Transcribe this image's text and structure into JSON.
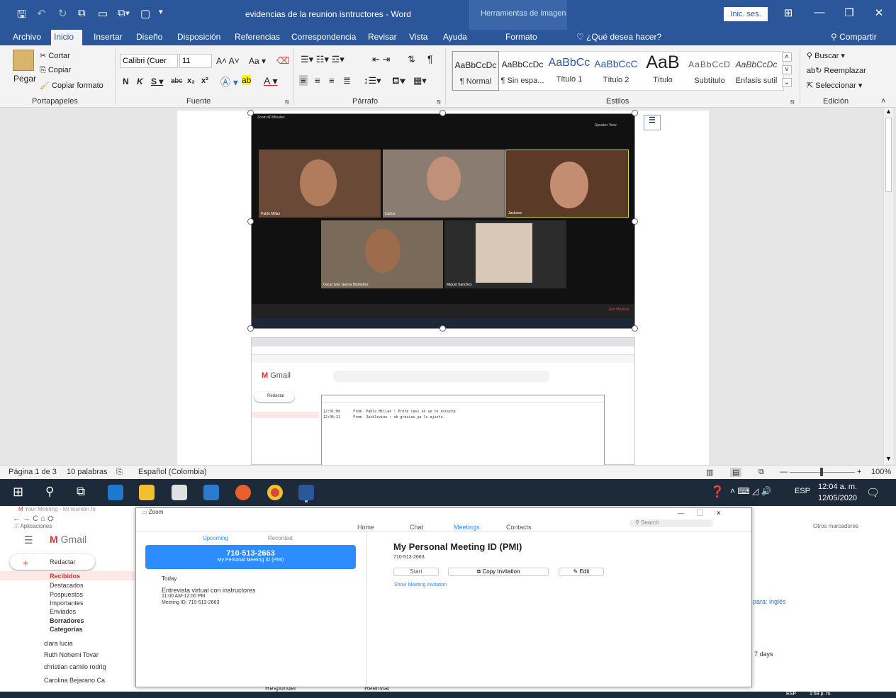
{
  "word": {
    "doc_title": "evidencias de la reunion isntructores  -  Word",
    "context_tab": "Herramientas de imagen",
    "signin": "Inic. ses.",
    "menu": [
      "Archivo",
      "Inicio",
      "Insertar",
      "Diseño",
      "Disposición",
      "Referencias",
      "Correspondencia",
      "Revisar",
      "Vista",
      "Ayuda",
      "Formato"
    ],
    "tell_me": "¿Qué desea hacer?",
    "share": "Compartir",
    "clipboard": {
      "paste": "Pegar",
      "cut": "Cortar",
      "copy": "Copiar",
      "format_painter": "Copiar formato",
      "label": "Portapapeles"
    },
    "font": {
      "name": "Calibri (Cuer",
      "size": "11",
      "label": "Fuente",
      "case": "Aa"
    },
    "paragraph_label": "Párrafo",
    "styles": {
      "label": "Estilos",
      "items": [
        {
          "sample": "AaBbCcDc",
          "name": "¶ Normal"
        },
        {
          "sample": "AaBbCcDc",
          "name": "¶ Sin espa..."
        },
        {
          "sample": "AaBbCc",
          "name": "Título 1"
        },
        {
          "sample": "AaBbCcC",
          "name": "Título 2"
        },
        {
          "sample": "AaB",
          "name": "Título"
        },
        {
          "sample": "AaBbCcD",
          "name": "Subtítulo"
        },
        {
          "sample": "AaBbCcDc",
          "name": "Énfasis sutil"
        }
      ]
    },
    "editing": {
      "find": "Buscar",
      "replace": "Reemplazar",
      "select": "Seleccionar",
      "label": "Edición"
    },
    "status": {
      "page": "Página 1 de 3",
      "words": "10 palabras",
      "language": "Español (Colombia)",
      "zoom": "100%"
    }
  },
  "embedded_zoom": {
    "title": "Zoom 40 Minutes",
    "speaker_view": "Speaker View",
    "participants": [
      "Pablo Millan",
      "Carlos",
      "Jacksive",
      "Oscar Ivan Garcia Montañez",
      "Miguel Sanchez"
    ],
    "end_meeting": "End Meeting"
  },
  "embedded_chat": {
    "line1": "12:01:08      From  Pablo Millan : Profe casi no se te escucha",
    "line2": "12:06:21      From  Jacklevine : ok gracias ya lo ajusto."
  },
  "taskbar": {
    "time": "12:04 a. m.",
    "date": "12/05/2020",
    "lang": "ESP"
  },
  "lower": {
    "gmail": {
      "tab_title": "Your Meeting - Mi reunión fe",
      "apps": "Aplicaciones",
      "bookmarks_other": "Otros marcadores",
      "logo": "Gmail",
      "compose": "Redactar",
      "nav": [
        "Recibidos",
        "Destacados",
        "Pospuestos",
        "Importantes",
        "Enviados",
        "Borradores",
        "Categorías"
      ],
      "contacts": [
        "clara lucia",
        "Ruth Nohemi Tovar",
        "christian camilo rodrig",
        "Carolina Bejarano Ca"
      ],
      "reply": "Responder",
      "forward": "Reenviar",
      "days": "7 days",
      "translate": "para: inglés"
    },
    "zoom": {
      "title": "Zoom",
      "tabs": [
        "Home",
        "Chat",
        "Meetings",
        "Contacts"
      ],
      "search": "Search",
      "upcoming": "Upcoming",
      "recorded": "Recorded",
      "pmi_number": "710-513-2663",
      "pmi_label": "My Personal Meeting ID (PMI)",
      "today": "Today",
      "meeting_title": "Entrevista virtual con instructores",
      "meeting_time": "11:00 AM-12:00 PM",
      "meeting_id": "Meeting ID: 710-513-2663",
      "heading": "My Personal Meeting ID (PMI)",
      "start": "Start",
      "copy_invitation": "Copy Invitation",
      "edit": "Edit",
      "show_invitation": "Show Meeting Invitation"
    },
    "taskbar_time": "1:59 p. m.",
    "taskbar_lang": "ESP"
  }
}
